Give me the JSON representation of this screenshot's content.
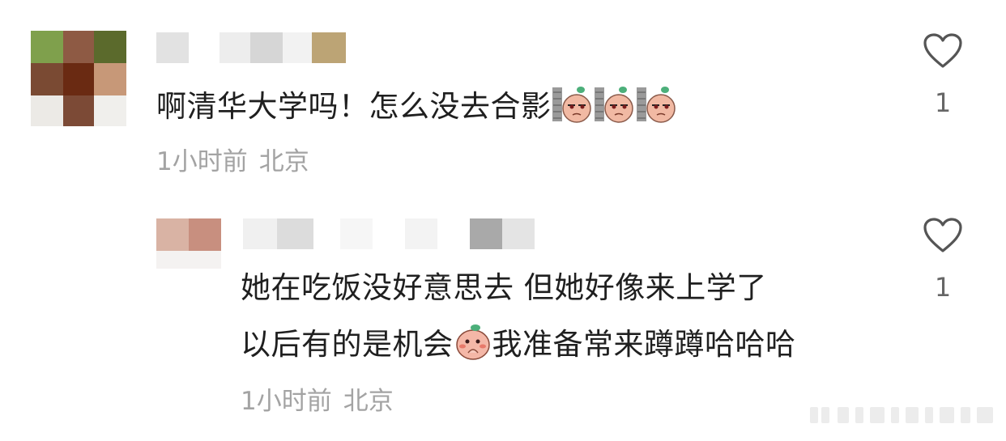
{
  "comments": [
    {
      "text": "啊清华大学吗！怎么没去合影",
      "emojis": [
        "peek-emoji",
        "peek-emoji",
        "peek-emoji"
      ],
      "time": "1小时前",
      "location": "北京",
      "likes": "1"
    },
    {
      "lines": [
        "她在吃饭没好意思去 但她好像来上学了",
        "以后有的是机会"
      ],
      "line2_tail": "我准备常来蹲蹲哈哈哈",
      "emoji": "shy-emoji",
      "time": "1小时前",
      "location": "北京",
      "likes": "1"
    }
  ],
  "icons": {
    "like": "heart-outline-icon"
  },
  "colors": {
    "text": "#1f1f1f",
    "meta": "#a3a3a3",
    "icon": "#555555"
  }
}
